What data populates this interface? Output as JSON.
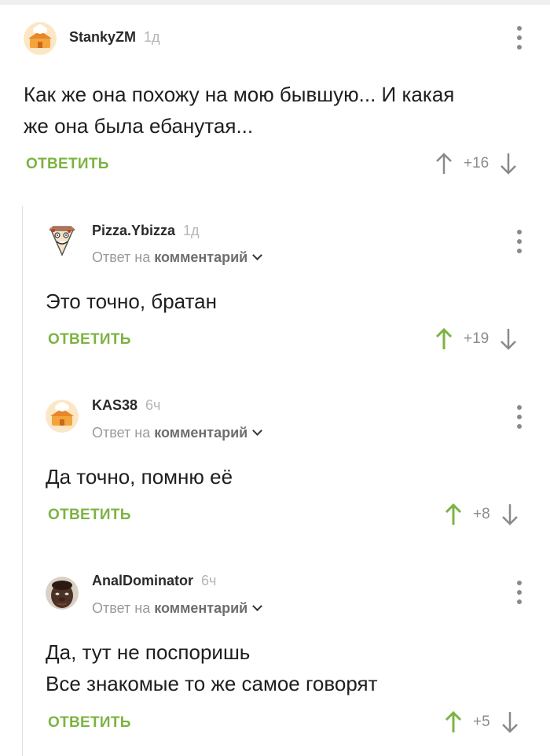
{
  "colors": {
    "accent": "#7cb342",
    "muted": "#9a9a9a",
    "arrow_neutral": "#8a8a8a",
    "arrow_up_active": "#7cb342"
  },
  "comments": [
    {
      "author": "StankyZM",
      "time": "1д",
      "avatar_icon": "chef-house-avatar",
      "text_lines": [
        "Как же она похожу на мою бывшую... И какая",
        "же она была ебанутая..."
      ],
      "reply_label": "ОТВЕТИТЬ",
      "score": "+16",
      "upvoted": false
    },
    {
      "author": "Pizza.Ybizza",
      "time": "1д",
      "avatar_icon": "pizza-face-avatar",
      "reply_prefix": "Ответ на",
      "reply_target": "комментарий",
      "text_lines": [
        "Это точно, братан"
      ],
      "reply_label": "ОТВЕТИТЬ",
      "score": "+19",
      "upvoted": true
    },
    {
      "author": "KAS38",
      "time": "6ч",
      "avatar_icon": "chef-house-avatar",
      "reply_prefix": "Ответ на",
      "reply_target": "комментарий",
      "text_lines": [
        "Да точно, помню её"
      ],
      "reply_label": "ОТВЕТИТЬ",
      "score": "+8",
      "upvoted": true
    },
    {
      "author": "AnalDominator",
      "time": "6ч",
      "avatar_icon": "man-face-avatar",
      "reply_prefix": "Ответ на",
      "reply_target": "комментарий",
      "text_lines": [
        "Да, тут не поспоришь",
        "Все знакомые то же самое говорят"
      ],
      "reply_label": "ОТВЕТИТЬ",
      "score": "+5",
      "upvoted": true
    }
  ]
}
